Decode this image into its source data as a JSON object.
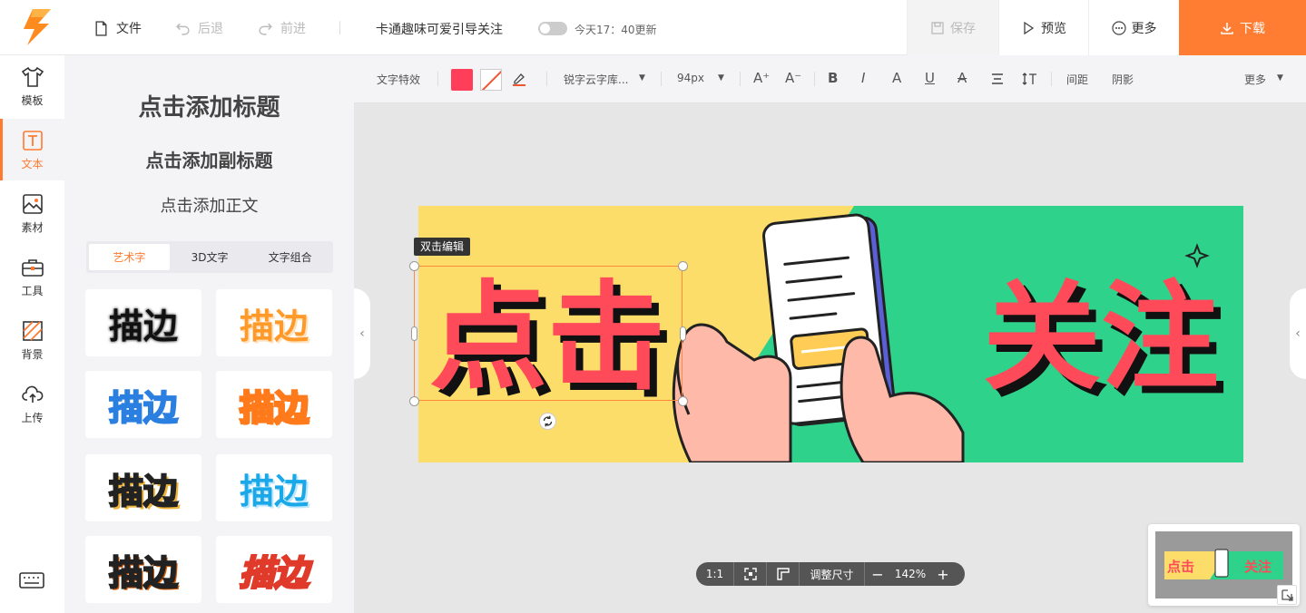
{
  "topbar": {
    "file": "文件",
    "undo": "后退",
    "redo": "前进",
    "doc_title": "卡通趣味可爱引导关注",
    "update_text": "今天17：40更新",
    "save": "保存",
    "preview": "预览",
    "more": "更多",
    "download": "下载"
  },
  "nav": {
    "items": [
      {
        "label": "模板",
        "icon": "tshirt-icon"
      },
      {
        "label": "文本",
        "icon": "text-icon"
      },
      {
        "label": "素材",
        "icon": "image-icon"
      },
      {
        "label": "工具",
        "icon": "toolbox-icon"
      },
      {
        "label": "背景",
        "icon": "background-icon"
      },
      {
        "label": "上传",
        "icon": "cloud-upload-icon"
      }
    ],
    "active": "文本"
  },
  "panel": {
    "add_title": "点击添加标题",
    "add_subtitle": "点击添加副标题",
    "add_body": "点击添加正文",
    "tabs": [
      "艺术字",
      "3D文字",
      "文字组合"
    ],
    "active_tab": "艺术字",
    "samples": [
      "描边",
      "描边",
      "描边",
      "描边",
      "描边",
      "描边",
      "描边",
      "描边"
    ]
  },
  "toolbar": {
    "text_effects": "文字特效",
    "font": "锐字云字库...",
    "size": "94px",
    "spacing": "间距",
    "shadow": "阴影",
    "more": "更多",
    "fill_color": "#ff3e5a"
  },
  "canvas": {
    "edit_hint": "双击编辑",
    "left_text": "点击",
    "right_text": "关注",
    "colors": {
      "yellow": "#fddd6a",
      "green": "#2fd28a",
      "red": "#ff4a5a"
    }
  },
  "zoom": {
    "ratio": "1:1",
    "resize": "调整尺寸",
    "level": "142%"
  }
}
